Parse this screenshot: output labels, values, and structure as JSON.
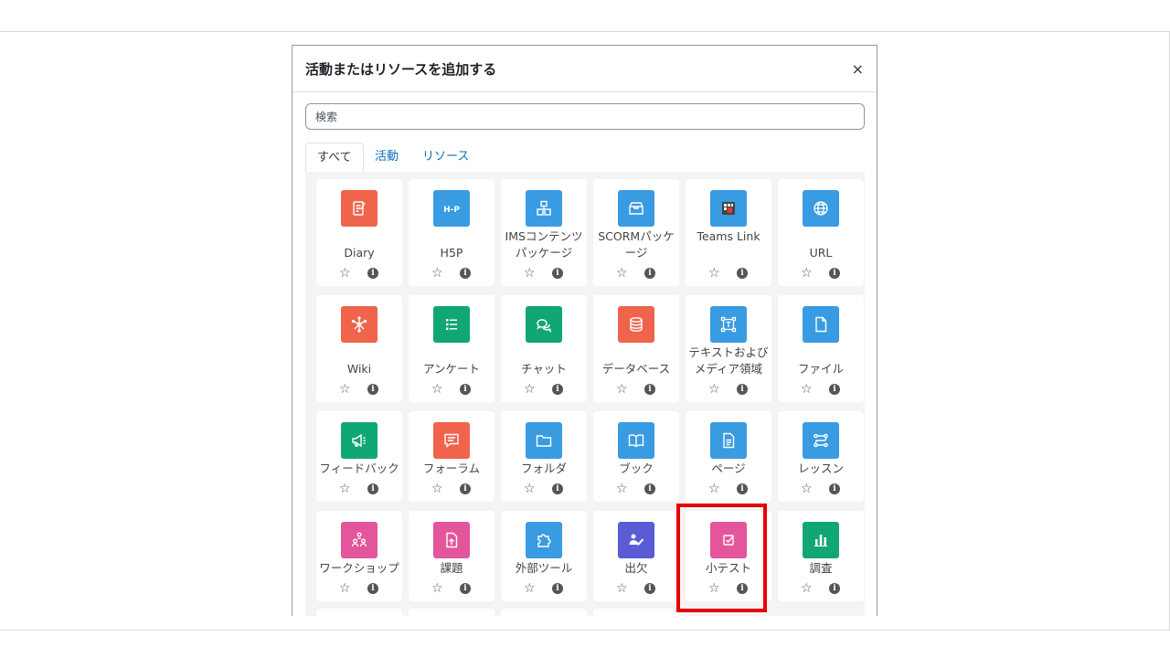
{
  "modal": {
    "title": "活動またはリソースを追加する",
    "close": "×",
    "search_placeholder": "検索"
  },
  "tabs": [
    {
      "label": "すべて",
      "active": true
    },
    {
      "label": "活動",
      "active": false
    },
    {
      "label": "リソース",
      "active": false
    }
  ],
  "items": [
    {
      "name": "Diary",
      "icon": "diary-icon",
      "color": "#f0644b"
    },
    {
      "name": "H5P",
      "icon": "h5p-icon",
      "color": "#399be2"
    },
    {
      "name": "IMSコンテンツパッケージ",
      "icon": "ims-package-icon",
      "color": "#399be2"
    },
    {
      "name": "SCORMパッケージ",
      "icon": "scorm-box-icon",
      "color": "#399be2"
    },
    {
      "name": "Teams Link",
      "icon": "teams-link-icon",
      "color": "#399be2"
    },
    {
      "name": "URL",
      "icon": "globe-icon",
      "color": "#399be2"
    },
    {
      "name": "Wiki",
      "icon": "wiki-network-icon",
      "color": "#f0644b"
    },
    {
      "name": "アンケート",
      "icon": "feedback-list-icon",
      "color": "#11a676"
    },
    {
      "name": "チャット",
      "icon": "chat-bubbles-icon",
      "color": "#11a676"
    },
    {
      "name": "データベース",
      "icon": "database-icon",
      "color": "#f0644b"
    },
    {
      "name": "テキストおよびメディア領域",
      "icon": "text-area-icon",
      "color": "#399be2"
    },
    {
      "name": "ファイル",
      "icon": "file-icon",
      "color": "#399be2"
    },
    {
      "name": "フィードバック",
      "icon": "megaphone-icon",
      "color": "#11a676"
    },
    {
      "name": "フォーラム",
      "icon": "forum-icon",
      "color": "#f0644b"
    },
    {
      "name": "フォルダ",
      "icon": "folder-icon",
      "color": "#399be2"
    },
    {
      "name": "ブック",
      "icon": "book-icon",
      "color": "#399be2"
    },
    {
      "name": "ページ",
      "icon": "page-icon",
      "color": "#399be2"
    },
    {
      "name": "レッスン",
      "icon": "lesson-path-icon",
      "color": "#399be2"
    },
    {
      "name": "ワークショップ",
      "icon": "workshop-people-icon",
      "color": "#e3569b"
    },
    {
      "name": "課題",
      "icon": "assignment-upload-icon",
      "color": "#e3569b"
    },
    {
      "name": "外部ツール",
      "icon": "puzzle-icon",
      "color": "#399be2"
    },
    {
      "name": "出欠",
      "icon": "attendance-icon",
      "color": "#5b5bd6"
    },
    {
      "name": "小テスト",
      "icon": "quiz-check-icon",
      "color": "#e3569b"
    },
    {
      "name": "調査",
      "icon": "survey-chart-icon",
      "color": "#11a676"
    }
  ],
  "favourite_glyph": "☆",
  "info_glyph": "i"
}
